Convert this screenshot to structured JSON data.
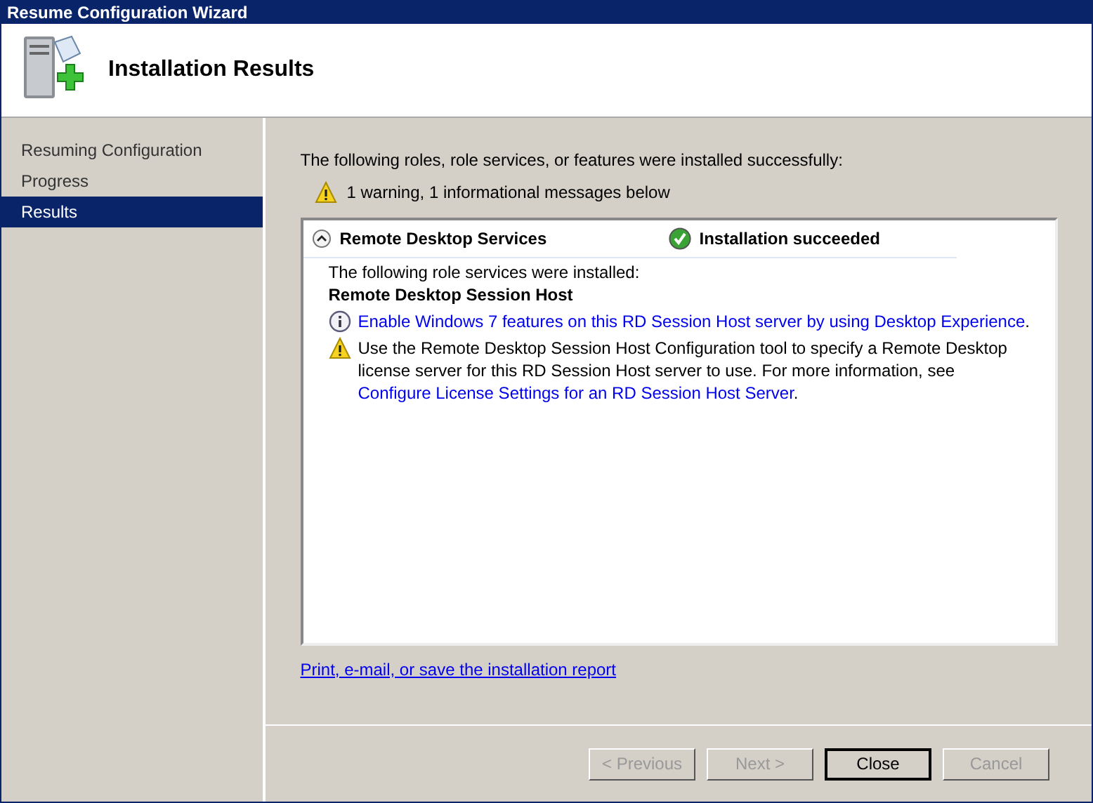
{
  "window": {
    "title": "Resume Configuration Wizard"
  },
  "header": {
    "title": "Installation Results"
  },
  "sidebar": {
    "items": [
      {
        "label": "Resuming Configuration",
        "selected": false
      },
      {
        "label": "Progress",
        "selected": false
      },
      {
        "label": "Results",
        "selected": true
      }
    ]
  },
  "intro": "The following roles, role services, or features were installed successfully:",
  "summary": {
    "kind": "warning",
    "text": "1 warning, 1 informational messages below"
  },
  "results": [
    {
      "role": "Remote Desktop Services",
      "expanded": true,
      "status": "Installation succeeded",
      "succeeded": true,
      "subtitle": "The following role services were installed:",
      "service": "Remote Desktop Session Host",
      "messages": [
        {
          "kind": "info",
          "parts": [
            {
              "text": "Enable Windows 7 features on this RD Session Host server by using Desktop Experience",
              "kind": "link"
            },
            {
              "text": ".",
              "kind": "text"
            }
          ]
        },
        {
          "kind": "warning",
          "parts": [
            {
              "text": "Use the Remote Desktop Session Host Configuration tool to specify a Remote Desktop license server for this RD Session Host server to use. For more information, see ",
              "kind": "text"
            },
            {
              "text": "Configure License Settings for an RD Session Host Server",
              "kind": "link"
            },
            {
              "text": ".",
              "kind": "text"
            }
          ]
        }
      ]
    }
  ],
  "report_link": "Print, e-mail, or save the installation report",
  "buttons": [
    {
      "label": "< Previous",
      "disabled": true,
      "default": false
    },
    {
      "label": "Next >",
      "disabled": true,
      "default": false
    },
    {
      "label": "Close",
      "disabled": false,
      "default": true
    },
    {
      "label": "Cancel",
      "disabled": true,
      "default": false
    }
  ]
}
